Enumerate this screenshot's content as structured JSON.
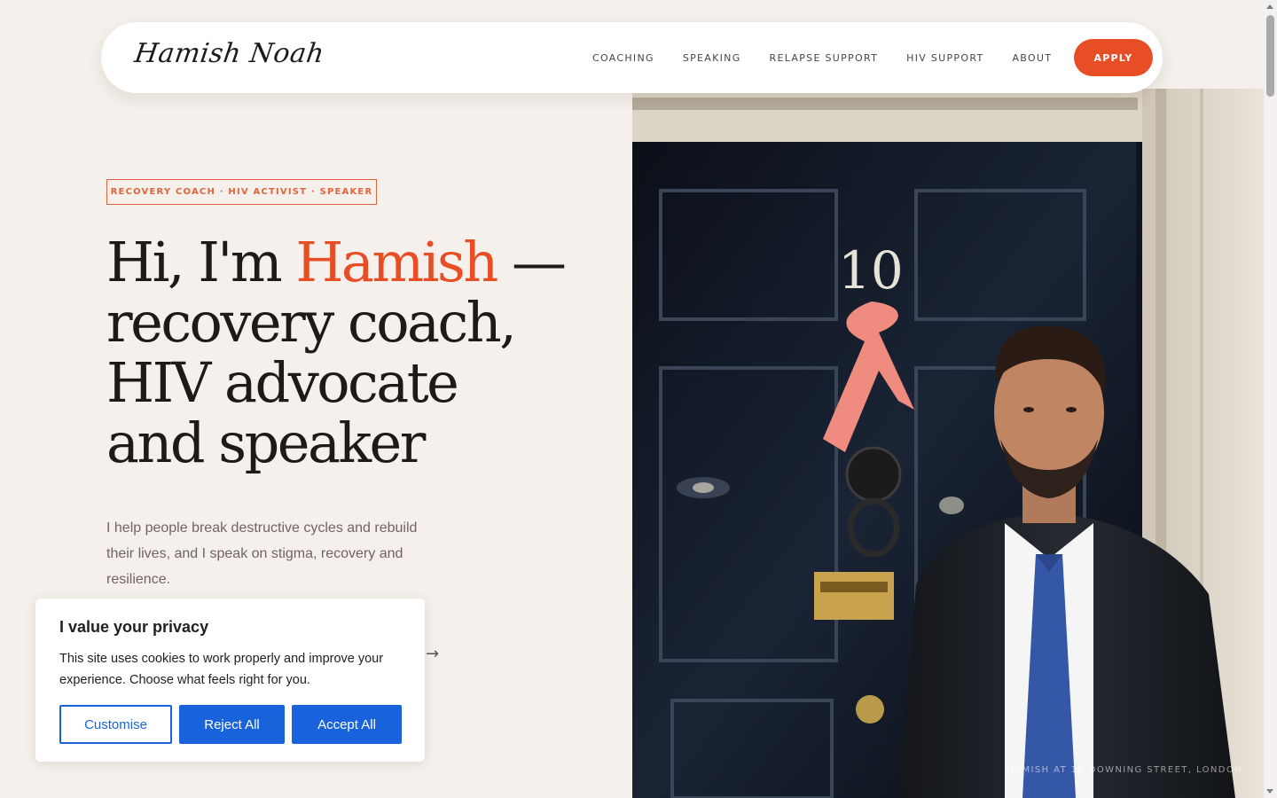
{
  "brand": {
    "logo_text": "Hamish Noah"
  },
  "nav": {
    "items": [
      {
        "label": "COACHING"
      },
      {
        "label": "SPEAKING"
      },
      {
        "label": "RELAPSE SUPPORT"
      },
      {
        "label": "HIV SUPPORT"
      },
      {
        "label": "ABOUT"
      }
    ],
    "apply_label": "APPLY"
  },
  "hero": {
    "tagline": "RECOVERY COACH · HIV ACTIVIST · SPEAKER",
    "headline_prefix": "Hi, I'm ",
    "headline_name": "Hamish",
    "headline_suffix": " — recovery coach, HIV advocate and speaker",
    "intro": "I help people break destructive cycles and rebuild their lives, and I speak on stigma, recovery and resilience.",
    "arrow": "→",
    "photo_caption": "HAMISH AT 10 DOWNING STREET, LONDON",
    "door_number": "10"
  },
  "cookie": {
    "title": "I value your privacy",
    "text": "This site uses cookies to work properly and improve your experience. Choose what feels right for you.",
    "customise_label": "Customise",
    "reject_label": "Reject All",
    "accept_label": "Accept All"
  },
  "colors": {
    "accent": "#e84e25",
    "page_bg": "#f5f0eb",
    "cookie_button": "#1863dc"
  },
  "icons": {
    "arrow": "arrow-right-icon"
  }
}
